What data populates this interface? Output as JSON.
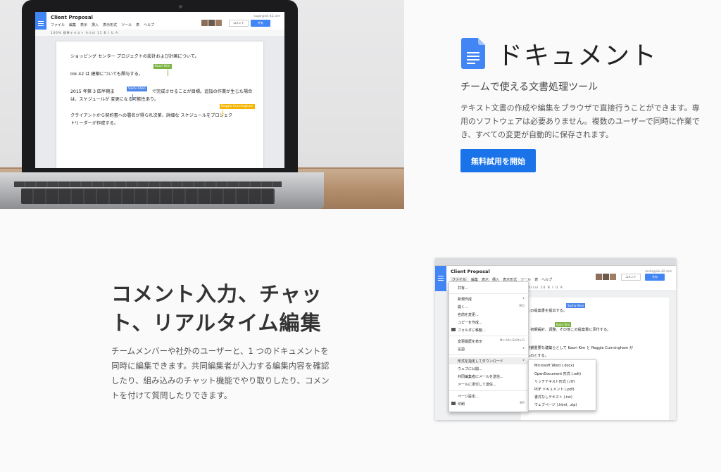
{
  "laptop_doc": {
    "title": "Client Proposal",
    "user": "sugar@ink-42.com",
    "menu": [
      "ファイル",
      "編集",
      "表示",
      "挿入",
      "表示形式",
      "ツール",
      "表",
      "ヘルプ"
    ],
    "comment_label": "コメント",
    "share_label": "共有",
    "toolbar_text": "100%  標準テキスト  Arial  11  B I U A",
    "lines": [
      "ショッピング センター プロジェクトの設計および計画について。",
      "Ink 42 は 建築についても関与する。",
      "2015 年第 3 四半期ま",
      "で完成させることが目標。追加の作業が生じた場合",
      "は、スケジュールが 変更になる可能性あり。",
      "クライアントから契約書への署名が得られ次第、詳細な スケジュールをプロジェク",
      "トリーダーが作成する。"
    ],
    "cursors": [
      {
        "name": "Kaori Kim",
        "color": "#7cb342"
      },
      {
        "name": "Sashi Allen",
        "color": "#4a86e8"
      },
      {
        "name": "Reggie Cunningham",
        "color": "#f4b400"
      }
    ]
  },
  "product": {
    "icon": "google-docs-icon",
    "title": "ドキュメント",
    "subtitle": "チームで使える文書処理ツール",
    "description": "テキスト文書の作成や編集をブラウザで直接行うことができます。専用のソフトウェアは必要ありません。複数のユーザーで同時に作業でき、すべての変更が自動的に保存されます。",
    "cta_label": "無料試用を開始",
    "accent": "#1a73e8"
  },
  "feature": {
    "title": "コメント入力、チャット、リアルタイム編集",
    "description": "チームメンバーや社外のユーザーと、1 つのドキュメントを同時に編集できます。共同編集者が入力する編集内容を確認したり、組み込みのチャット機能でやり取りしたり、コメントを付けて質問したりできます。"
  },
  "screenshot": {
    "title": "Client Proposal",
    "user": "sasha@ink-42.com",
    "menu": [
      "ファイル",
      "編集",
      "表示",
      "挿入",
      "表示形式",
      "ツール",
      "表",
      "ヘルプ"
    ],
    "comment_label": "コメント",
    "share_label": "共有",
    "toolbar_text": "Arial  10  B I U A",
    "doc_lines": [
      "この提案書を提出する。",
      "、初期設計、调整、その他この提案書に添付する。",
      "注観重要な建築士として Kaori Kim と Reggie Cunningham が",
      "ものとする。"
    ],
    "doc_cursors": [
      "Sasha Allen",
      "Kaori Kim"
    ],
    "file_menu": [
      {
        "label": "共有...",
        "shortcut": ""
      },
      {
        "label": "新規作成",
        "shortcut": "▸"
      },
      {
        "label": "開く...",
        "shortcut": "⌘O"
      },
      {
        "label": "名前を変更...",
        "shortcut": ""
      },
      {
        "label": "コピーを作成...",
        "shortcut": ""
      },
      {
        "label": "フォルダに移動...",
        "shortcut": ""
      },
      {
        "label": "変更履歴を表示",
        "shortcut": "⌘+Alt+Shift+G"
      },
      {
        "label": "言語",
        "shortcut": "▸"
      },
      {
        "label": "形式を指定してダウンロード",
        "shortcut": "▸"
      },
      {
        "label": "ウェブに公開...",
        "shortcut": ""
      },
      {
        "label": "共同編集者にメールを送信...",
        "shortcut": ""
      },
      {
        "label": "メールに添付して送信...",
        "shortcut": ""
      },
      {
        "label": "ページ設定...",
        "shortcut": ""
      },
      {
        "label": "印刷",
        "shortcut": "⌘P"
      }
    ],
    "download_submenu": [
      "Microsoft Word (.docx)",
      "OpenDocument 形式 (.odt)",
      "リッチテキスト形式 (.rtf)",
      "PDF ドキュメント (.pdf)",
      "書式なしテキスト (.txt)",
      "ウェブページ (.html, .zip)"
    ]
  }
}
